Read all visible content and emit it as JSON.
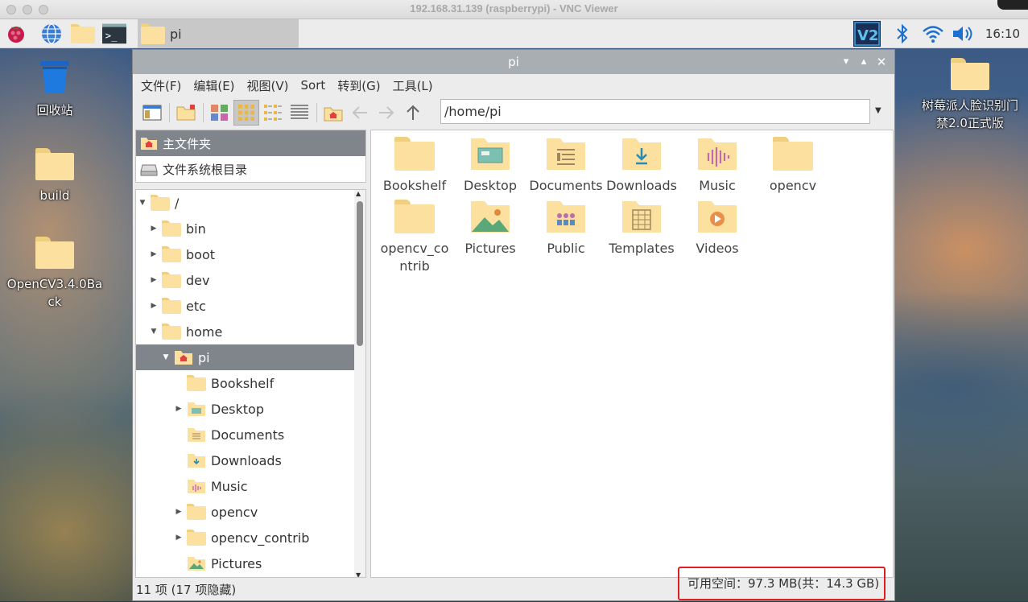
{
  "mac_window": {
    "title": "192.168.31.139 (raspberrypi) - VNC Viewer"
  },
  "taskbar": {
    "task_label": "pi",
    "clock": "16:10",
    "tray_icons": [
      "vnc-icon",
      "bluetooth-icon",
      "wifi-icon",
      "volume-icon"
    ]
  },
  "desktop": {
    "icons": [
      {
        "label": "回收站",
        "icon": "trash-icon"
      },
      {
        "label": "build",
        "icon": "folder-icon"
      },
      {
        "label": "OpenCV3.4.0Back",
        "icon": "folder-icon"
      },
      {
        "label": "树莓派人脸识别门禁2.0正式版",
        "icon": "folder-icon"
      }
    ]
  },
  "window": {
    "title": "pi",
    "menu": [
      "文件(F)",
      "编辑(E)",
      "视图(V)",
      "Sort",
      "转到(G)",
      "工具(L)"
    ],
    "address": "/home/pi",
    "places": [
      {
        "label": "主文件夹",
        "icon": "home-icon"
      },
      {
        "label": "文件系统根目录",
        "icon": "drive-icon"
      }
    ],
    "tree": [
      {
        "label": "/",
        "depth": 0
      },
      {
        "label": "bin",
        "depth": 1
      },
      {
        "label": "boot",
        "depth": 1
      },
      {
        "label": "dev",
        "depth": 1
      },
      {
        "label": "etc",
        "depth": 1
      },
      {
        "label": "home",
        "depth": 1
      },
      {
        "label": "pi",
        "depth": 2
      },
      {
        "label": "Bookshelf",
        "depth": 3
      },
      {
        "label": "Desktop",
        "depth": 3
      },
      {
        "label": "Documents",
        "depth": 3
      },
      {
        "label": "Downloads",
        "depth": 3
      },
      {
        "label": "Music",
        "depth": 3
      },
      {
        "label": "opencv",
        "depth": 3
      },
      {
        "label": "opencv_contrib",
        "depth": 3
      },
      {
        "label": "Pictures",
        "depth": 3
      }
    ],
    "items": [
      {
        "label": "Bookshelf",
        "icon": "folder-icon"
      },
      {
        "label": "Desktop",
        "icon": "desktop-folder-icon"
      },
      {
        "label": "Documents",
        "icon": "documents-folder-icon"
      },
      {
        "label": "Downloads",
        "icon": "downloads-folder-icon"
      },
      {
        "label": "Music",
        "icon": "music-folder-icon"
      },
      {
        "label": "opencv",
        "icon": "folder-icon"
      },
      {
        "label": "opencv_contrib",
        "icon": "folder-icon"
      },
      {
        "label": "Pictures",
        "icon": "pictures-folder-icon"
      },
      {
        "label": "Public",
        "icon": "public-folder-icon"
      },
      {
        "label": "Templates",
        "icon": "templates-folder-icon"
      },
      {
        "label": "Videos",
        "icon": "videos-folder-icon"
      }
    ],
    "status_left": "11 项 (17 项隐藏)",
    "status_right": "可用空间：97.3 MB(共：14.3 GB)"
  },
  "colors": {
    "selection": "#7f858a",
    "folder": "#fbe0a0",
    "titlebar": "#a9aeb3",
    "highlight_box": "#e02020"
  }
}
